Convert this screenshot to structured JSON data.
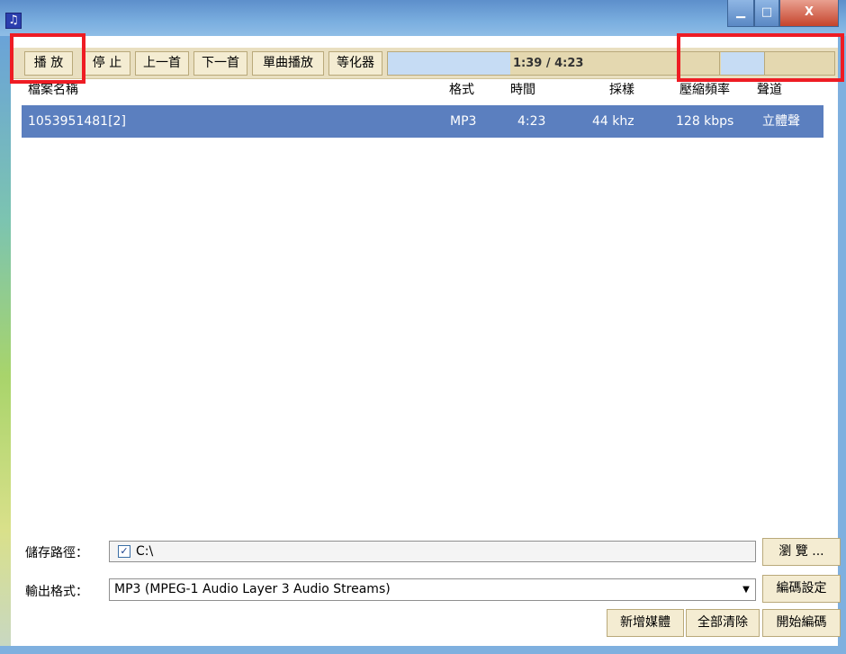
{
  "window": {
    "icon": "music-note-icon",
    "controls": {
      "minimize": "▁",
      "maximize": "□",
      "close": "X"
    }
  },
  "toolbar": {
    "play": "播 放",
    "stop": "停 止",
    "prev": "上一首",
    "next": "下一首",
    "single_play": "單曲播放",
    "equalizer": "等化器",
    "time": "1:39 / 4:23",
    "progress": 0.38
  },
  "list": {
    "columns": [
      "檔案名稱",
      "格式",
      "時間",
      "採樣",
      "壓縮頻率",
      "聲道"
    ],
    "rows": [
      {
        "name": "1053951481[2]",
        "format": "MP3",
        "time": "4:23",
        "sample": "44 khz",
        "bitrate": "128 kbps",
        "channel": "立體聲"
      }
    ]
  },
  "output": {
    "path_label": "儲存路徑：",
    "path_value": "C:\\",
    "path_checked": true,
    "browse": "瀏 覽 ...",
    "format_label": "輸出格式：",
    "format_value": "MP3  (MPEG-1 Audio Layer 3 Audio Streams)",
    "encode_settings": "編碼設定"
  },
  "actions": {
    "add_media": "新增媒體",
    "clear_all": "全部清除",
    "start_encode": "開始編碼"
  },
  "colors": {
    "highlight": "#ee1c24",
    "selection": "#5b7fbf",
    "toolbar_bg": "#e9dfc0"
  }
}
